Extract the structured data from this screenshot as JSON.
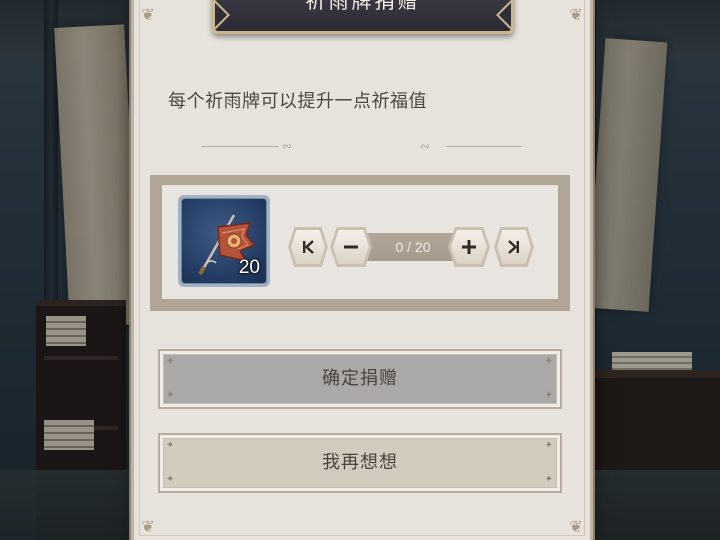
{
  "dialog": {
    "title": "祈雨牌捐赠",
    "description": "每个祈雨牌可以提升一点祈福值"
  },
  "item": {
    "icon": "red-banner-flag-icon",
    "count": "20"
  },
  "stepper": {
    "value_text": "0 / 20",
    "current": 0,
    "max": 20,
    "first_icon": "skip-to-min-icon",
    "minus_icon": "minus-icon",
    "plus_icon": "plus-icon",
    "last_icon": "skip-to-max-icon"
  },
  "buttons": {
    "confirm_label": "确定捐赠",
    "cancel_label": "我再想想"
  },
  "colors": {
    "dialog_bg": "#e7e2dc",
    "title_plate": "#2b2a34",
    "item_slot_bg": "#223a61",
    "confirm_bg": "#aba9a7",
    "cancel_bg": "#d3cbbd"
  }
}
